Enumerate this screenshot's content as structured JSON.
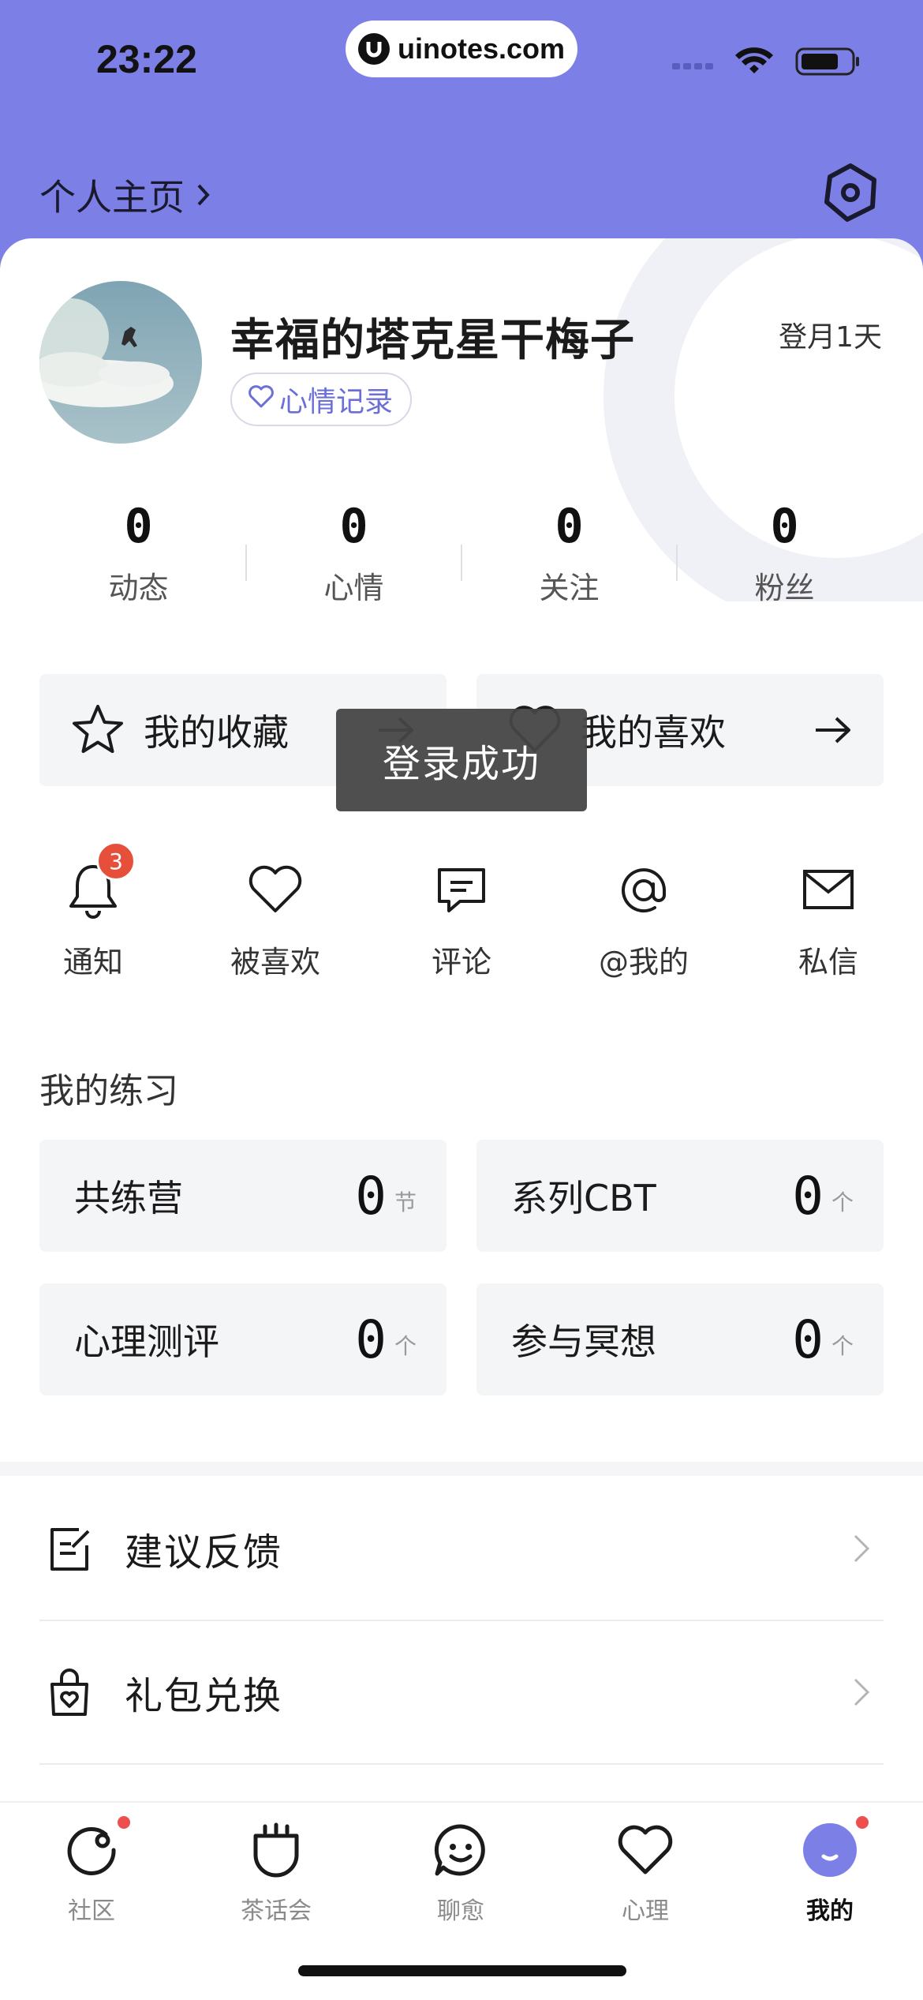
{
  "status_bar": {
    "time": "23:22",
    "url": "uinotes.com"
  },
  "header": {
    "title": "个人主页",
    "chevron": "›"
  },
  "profile": {
    "name": "幸福的塔克星干梅子",
    "mood_tag": "心情记录",
    "days": "登月1天"
  },
  "stats": [
    {
      "value": "0",
      "label": "动态"
    },
    {
      "value": "0",
      "label": "心情"
    },
    {
      "value": "0",
      "label": "关注"
    },
    {
      "value": "0",
      "label": "粉丝"
    }
  ],
  "quick_actions": [
    {
      "label": "我的收藏",
      "icon": "star-icon"
    },
    {
      "label": "我的喜欢",
      "icon": "heart-icon"
    }
  ],
  "messages": [
    {
      "label": "通知",
      "icon": "bell-icon",
      "badge": "3"
    },
    {
      "label": "被喜欢",
      "icon": "heart-outline-icon"
    },
    {
      "label": "评论",
      "icon": "comment-icon"
    },
    {
      "label": "@我的",
      "icon": "at-icon"
    },
    {
      "label": "私信",
      "icon": "mail-icon"
    }
  ],
  "toast": "登录成功",
  "practice": {
    "title": "我的练习",
    "items": [
      {
        "label": "共练营",
        "value": "0",
        "unit": "节"
      },
      {
        "label": "系列CBT",
        "value": "0",
        "unit": "个"
      },
      {
        "label": "心理测评",
        "value": "0",
        "unit": "个"
      },
      {
        "label": "参与冥想",
        "value": "0",
        "unit": "个"
      }
    ]
  },
  "menu": [
    {
      "label": "建议反馈",
      "icon": "feedback-icon"
    },
    {
      "label": "礼包兑换",
      "icon": "gift-bag-icon"
    }
  ],
  "tabs": [
    {
      "label": "社区",
      "icon": "community-icon",
      "dot": true
    },
    {
      "label": "茶话会",
      "icon": "tea-cup-icon",
      "dot": false
    },
    {
      "label": "聊愈",
      "icon": "chat-smile-icon",
      "dot": false
    },
    {
      "label": "心理",
      "icon": "heart-tab-icon",
      "dot": false
    },
    {
      "label": "我的",
      "icon": "profile-tab-icon",
      "dot": true,
      "active": true
    }
  ],
  "colors": {
    "header": "#7c80e6",
    "accent": "#6b6fd6",
    "badge": "#e6503a"
  }
}
